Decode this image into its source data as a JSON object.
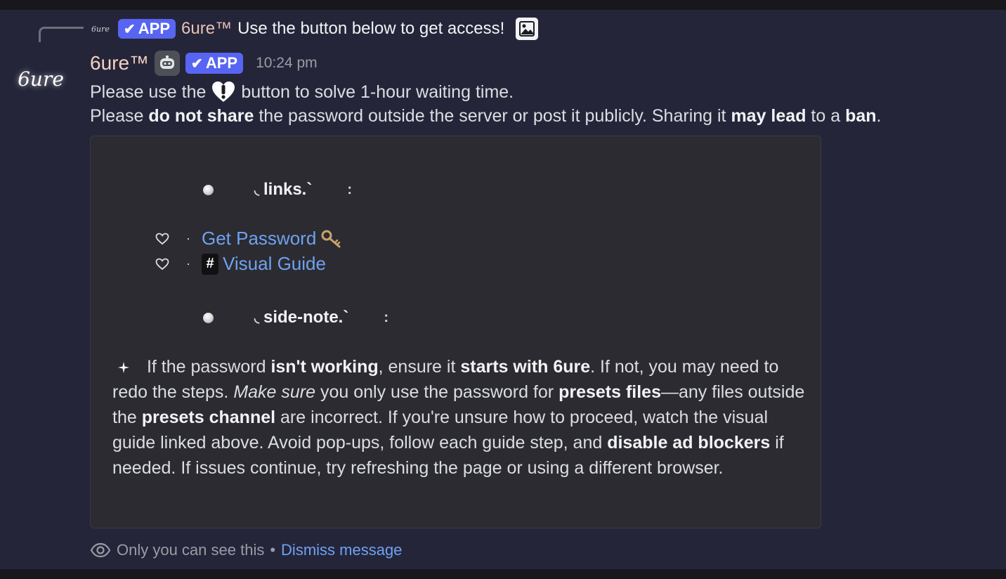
{
  "reply": {
    "avatar_text": "6ure",
    "badge": "APP",
    "username": "6ure™",
    "text": "Use the button below to get access!",
    "icon": "image-icon"
  },
  "message": {
    "avatar_text": "6ure",
    "username": "6ure™",
    "badge": "APP",
    "timestamp": "10:24 pm",
    "line1_before": "Please use the",
    "line1_after": "button to solve 1-hour waiting time.",
    "line2": {
      "part1": "Please ",
      "bold1": "do not share",
      "part2": " the password outside the server or post it publicly. Sharing it ",
      "bold2": "may lead",
      "part3": " to a ",
      "bold3": "ban",
      "part4": "."
    }
  },
  "embed": {
    "links_title": "links.`",
    "links": [
      {
        "label": "Get Password",
        "icon": "key-icon"
      },
      {
        "label": "Visual Guide",
        "icon": "hash-icon",
        "prefix": "#"
      }
    ],
    "side_title": "side-note.`",
    "note": {
      "t1": " If the password ",
      "b1": "isn't working",
      "t2": ", ensure it ",
      "b2": "starts with 6ure",
      "t3": ". If not, you may need to redo the steps. ",
      "i1": "Make sure",
      "t4": " you only use the password for ",
      "b3": "presets files",
      "t5": "—any files outside the ",
      "b4": "presets channel",
      "t6": " are incorrect. If you're unsure how to proceed, watch the visual guide linked above. Avoid pop-ups, follow each guide step, and ",
      "b5": "disable ad blockers",
      "t7": " if needed. If issues continue, try refreshing the page or using a different browser."
    }
  },
  "footer": {
    "only_you": "Only you can see this",
    "separator": "•",
    "dismiss": "Dismiss message"
  },
  "colors": {
    "background": "#25253a",
    "accent": "#5865f2",
    "link": "#6fa2f0"
  }
}
